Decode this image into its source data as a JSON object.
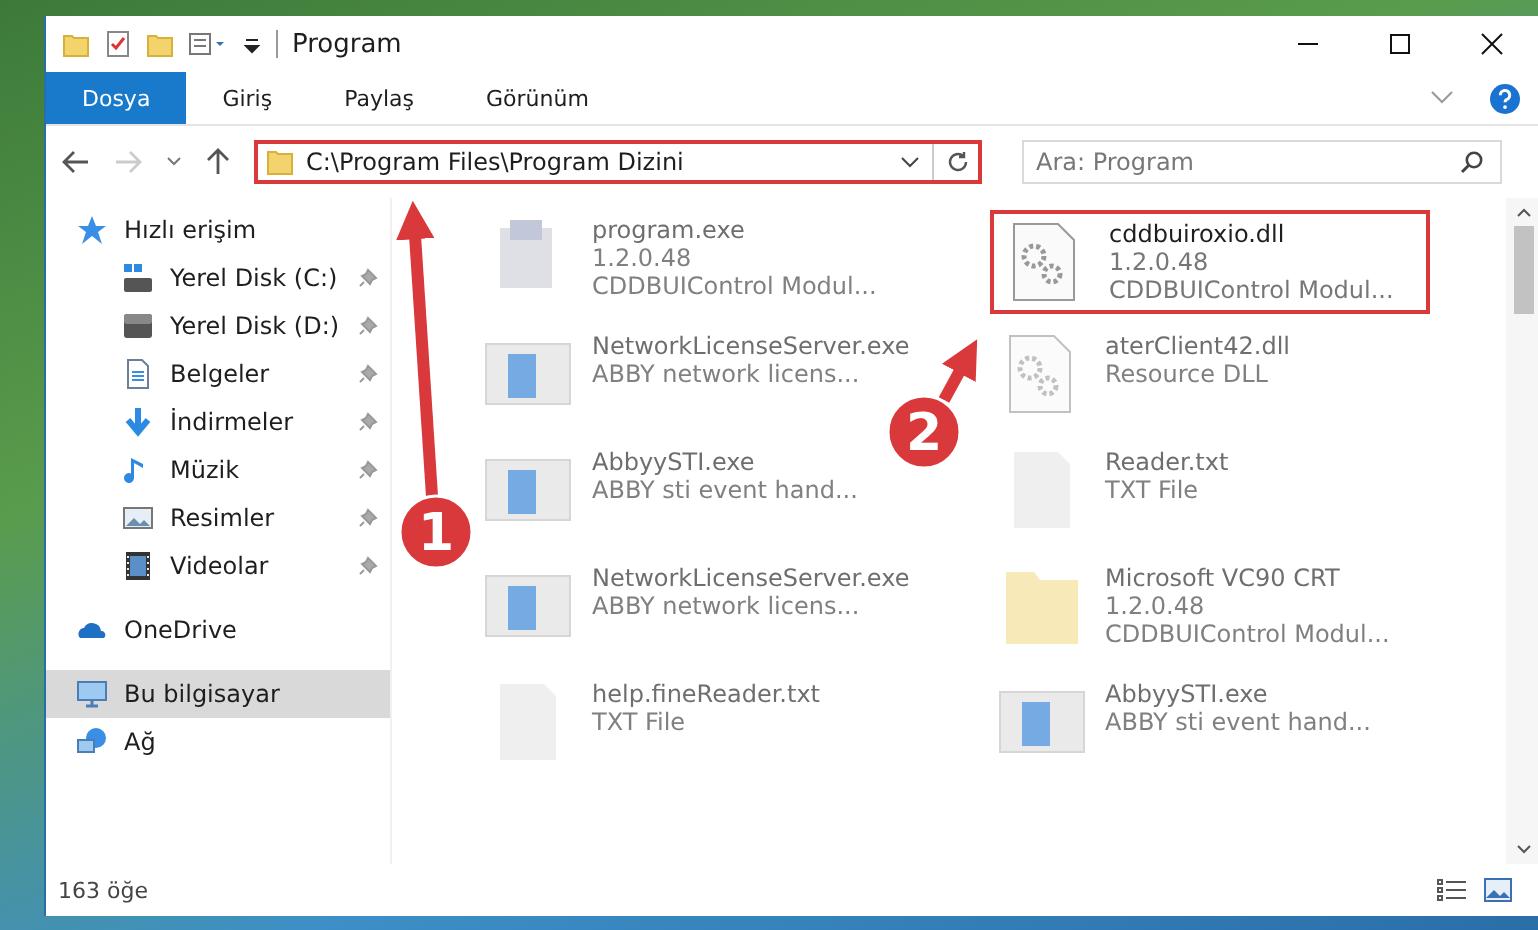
{
  "window": {
    "title": "Program"
  },
  "ribbon_tabs": [
    {
      "label": "Dosya",
      "selected": true
    },
    {
      "label": "Giriş",
      "selected": false
    },
    {
      "label": "Paylaş",
      "selected": false
    },
    {
      "label": "Görünüm",
      "selected": false
    }
  ],
  "address_bar": {
    "path": "C:\\Program Files\\Program Dizini",
    "highlighted": true
  },
  "search": {
    "placeholder": "Ara: Program"
  },
  "sidebar": {
    "items": [
      {
        "label": "Hızlı erişim",
        "kind": "star",
        "pinned": false,
        "selected": false
      },
      {
        "label": "Yerel Disk (C:)",
        "kind": "drive-c",
        "pinned": true,
        "selected": false
      },
      {
        "label": "Yerel Disk (D:)",
        "kind": "drive",
        "pinned": true,
        "selected": false
      },
      {
        "label": "Belgeler",
        "kind": "docs",
        "pinned": true,
        "selected": false
      },
      {
        "label": "İndirmeler",
        "kind": "download",
        "pinned": true,
        "selected": false
      },
      {
        "label": "Müzik",
        "kind": "music",
        "pinned": true,
        "selected": false
      },
      {
        "label": "Resimler",
        "kind": "pictures",
        "pinned": true,
        "selected": false
      },
      {
        "label": "Videolar",
        "kind": "video",
        "pinned": true,
        "selected": false
      },
      {
        "label": "OneDrive",
        "kind": "cloud",
        "pinned": false,
        "selected": false
      },
      {
        "label": "Bu bilgisayar",
        "kind": "pc",
        "pinned": false,
        "selected": true
      },
      {
        "label": "Ağ",
        "kind": "network",
        "pinned": false,
        "selected": false
      }
    ]
  },
  "files": [
    {
      "name": "program.exe",
      "lines": [
        "1.2.0.48",
        "CDDBUIControl Modul..."
      ],
      "kind": "app",
      "blurred": true,
      "highlighted": false
    },
    {
      "name": "cddbuiroxio.dll",
      "lines": [
        "1.2.0.48",
        "CDDBUIControl Modul..."
      ],
      "kind": "dll",
      "blurred": false,
      "highlighted": true
    },
    {
      "name": "NetworkLicenseServer.exe",
      "lines": [
        "ABBY network licens..."
      ],
      "kind": "window",
      "blurred": true,
      "highlighted": false
    },
    {
      "name": "aterClient42.dll",
      "lines": [
        "Resource DLL"
      ],
      "kind": "dll",
      "blurred": true,
      "highlighted": false
    },
    {
      "name": "AbbyySTI.exe",
      "lines": [
        "ABBY sti event hand..."
      ],
      "kind": "window",
      "blurred": true,
      "highlighted": false
    },
    {
      "name": "Reader.txt",
      "lines": [
        "TXT File"
      ],
      "kind": "text",
      "blurred": true,
      "highlighted": false
    },
    {
      "name": "NetworkLicenseServer.exe",
      "lines": [
        "ABBY network licens..."
      ],
      "kind": "window",
      "blurred": true,
      "highlighted": false
    },
    {
      "name": "Microsoft VC90 CRT",
      "lines": [
        "1.2.0.48",
        "CDDBUIControl Modul..."
      ],
      "kind": "folder",
      "blurred": true,
      "highlighted": false
    },
    {
      "name": "help.fineReader.txt",
      "lines": [
        "TXT File"
      ],
      "kind": "text",
      "blurred": true,
      "highlighted": false
    },
    {
      "name": "AbbyySTI.exe",
      "lines": [
        "ABBY sti event hand..."
      ],
      "kind": "window",
      "blurred": true,
      "highlighted": false
    }
  ],
  "status_bar": {
    "count": "163 öğe"
  },
  "annotations": [
    {
      "number": "1"
    },
    {
      "number": "2"
    }
  ]
}
